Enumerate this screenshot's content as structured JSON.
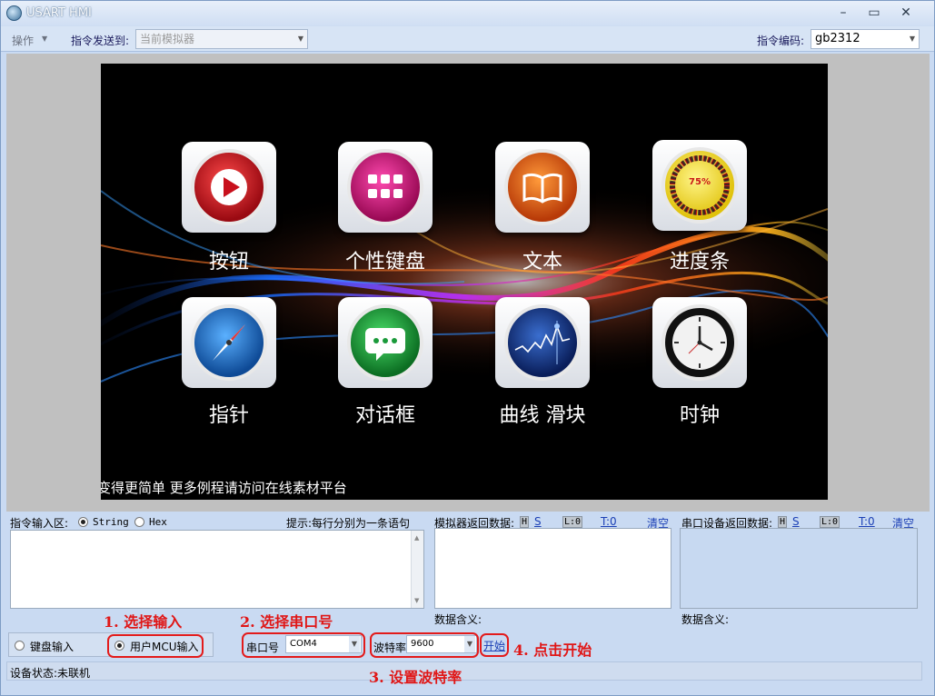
{
  "window": {
    "title": "USART HMI",
    "min": "–",
    "max": "▭",
    "close": "✕"
  },
  "toolbar": {
    "ops_menu": "操作",
    "send_to_label": "指令发送到:",
    "send_to_value": "当前模拟器",
    "encoding_label": "指令编码:",
    "encoding_value": "gb2312"
  },
  "simulator": {
    "apps": [
      {
        "label": "按钮",
        "icon": "play-button-icon",
        "color": "#c8101c"
      },
      {
        "label": "个性键盘",
        "icon": "keypad-icon",
        "color": "#c8126a"
      },
      {
        "label": "文本",
        "icon": "book-icon",
        "color": "#e0590e"
      },
      {
        "label": "进度条",
        "icon": "progress-gauge-icon",
        "color": "#e6d20f",
        "value": "75%"
      },
      {
        "label": "指针",
        "icon": "compass-icon",
        "color": "#1f78c8"
      },
      {
        "label": "对话框",
        "icon": "chat-bubble-icon",
        "color": "#1a9a3a"
      },
      {
        "label": "曲线 滑块",
        "icon": "curve-chart-icon",
        "color": "#1a3c8c"
      },
      {
        "label": "时钟",
        "icon": "clock-icon",
        "color": "#222222"
      }
    ],
    "marquee": "变得更简单 更多例程请访问在线素材平台"
  },
  "input_area": {
    "label": "指令输入区:",
    "opt_string": "String",
    "opt_hex": "Hex",
    "hint": "提示:每行分别为一条语句"
  },
  "sim_return": {
    "label": "模拟器返回数据:",
    "h": "H",
    "s": "S",
    "l": "L:0",
    "t": "T:0",
    "clear": "清空",
    "meaning": "数据含义:"
  },
  "dev_return": {
    "label": "串口设备返回数据:",
    "h": "H",
    "s": "S",
    "l": "L:0",
    "t": "T:0",
    "clear": "清空",
    "meaning": "数据含义:"
  },
  "controls": {
    "keyboard_input": "键盘输入",
    "mcu_input": "用户MCU输入",
    "port_label": "串口号",
    "port_value": "COM4",
    "baud_label": "波特率",
    "baud_value": "9600",
    "start": "开始"
  },
  "annotations": {
    "step1": "1. 选择输入",
    "step2": "2. 选择串口号",
    "step3": "3. 设置波特率",
    "step4": "4. 点击开始"
  },
  "status": {
    "text": "设备状态:未联机"
  }
}
